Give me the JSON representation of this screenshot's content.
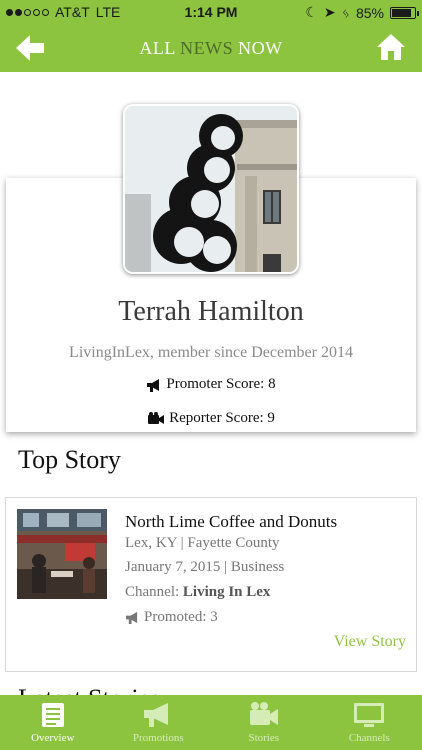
{
  "status_bar": {
    "carrier": "AT&T",
    "network": "LTE",
    "time": "1:14 PM",
    "battery": "85%",
    "battery_level": 0.85
  },
  "nav": {
    "title_part1": "ALL ",
    "title_part2": "NEWS",
    "title_part3": " NOW"
  },
  "profile": {
    "name": "Terrah Hamilton",
    "subtitle": "LivingInLex, member since December 2014",
    "promoter_score": "Promoter Score: 8",
    "reporter_score": "Reporter Score: 9"
  },
  "top_story": {
    "section_title": "Top Story",
    "headline": "North Lime Coffee and Donuts",
    "location": "Lex, KY | Fayette County",
    "date_category": "January 7, 2015 | Business",
    "channel_label": "Channel: ",
    "channel_name": "Living In Lex",
    "promoted": "Promoted: 3",
    "view_link": "View Story"
  },
  "latest": {
    "section_title": "Latest Stories"
  },
  "tabs": [
    {
      "label": "Overview",
      "icon": "document-icon",
      "active": true
    },
    {
      "label": "Promotions",
      "icon": "megaphone-icon",
      "active": false
    },
    {
      "label": "Stories",
      "icon": "video-camera-icon",
      "active": false
    },
    {
      "label": "Channels",
      "icon": "monitor-icon",
      "active": false
    }
  ],
  "colors": {
    "accent": "#8dc43f",
    "nav_muted": "#4e6b2c"
  }
}
